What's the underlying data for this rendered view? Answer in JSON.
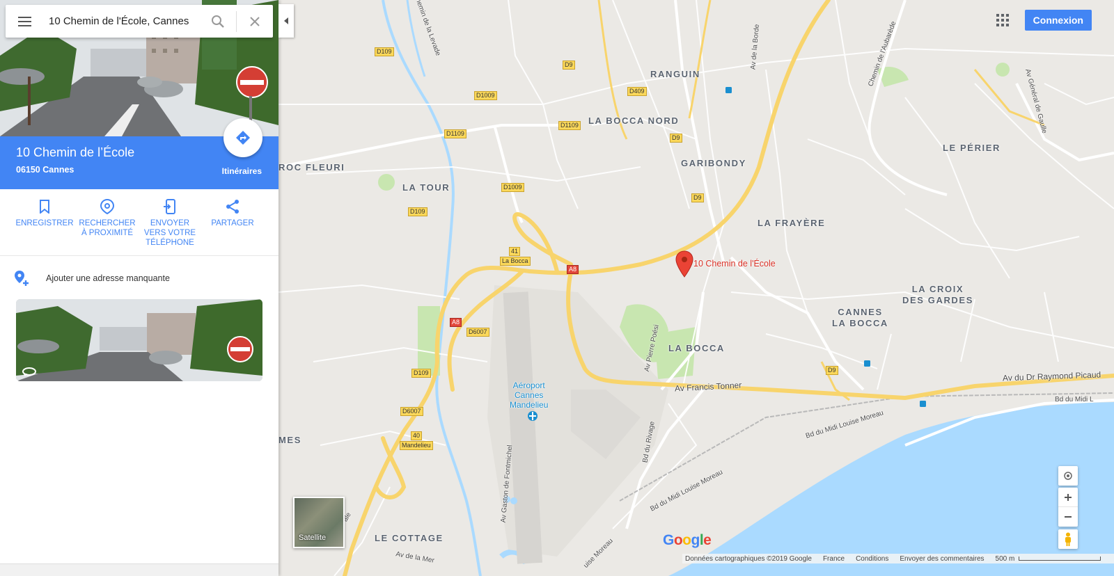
{
  "search": {
    "value": "10 Chemin de l'École, Cannes"
  },
  "place": {
    "title": "10 Chemin de l’École",
    "subtitle": "06150 Cannes",
    "directions_label": "Itinéraires"
  },
  "actions": [
    {
      "label": "ENREGISTRER",
      "icon": "bookmark-icon"
    },
    {
      "label": "RECHERCHER\nÀ PROXIMITÉ",
      "icon": "nearby-icon"
    },
    {
      "label": "ENVOYER\nVERS VOTRE\nTÉLÉPHONE",
      "icon": "send-to-phone-icon"
    },
    {
      "label": "PARTAGER",
      "icon": "share-icon"
    }
  ],
  "add_address_label": "Ajouter une adresse manquante",
  "header_buttons": {
    "signin": "Connexion"
  },
  "map": {
    "pin_label": "10 Chemin de l'École",
    "places": [
      "RANGUIN",
      "LA BOCCA NORD",
      "GARIBONDY",
      "LE PÉRIER",
      "ROC FLEURI",
      "LA TOUR",
      "LA FRAYÈRE",
      "LA CROIX\nDES GARDES",
      "CANNES\nLA BOCCA",
      "LA BOCCA",
      "MES",
      "LE COTTAGE"
    ],
    "streets": [
      "Av Francis Tonner",
      "Av du Dr Raymond Picaud",
      "Bd du Midi Louise Moreau",
      "Bd du Midi Louise Moreau",
      "Bd du Rivage",
      "Av Pierre Poési",
      "Av Gaston de Fontmichel",
      "Chemin de la Levade",
      "Av de la Borde",
      "Chemin de l'Aubarède",
      "Av Général de Gaulle",
      "Bd du Midi L",
      "ale",
      "Av de la Mer",
      "uise Moreau"
    ],
    "shields": [
      "D109",
      "D9",
      "D1009",
      "D409",
      "D1109",
      "D1109",
      "D9",
      "D1009",
      "D9",
      "D109",
      "41",
      "La Bocca",
      "A8",
      "A8",
      "D6007",
      "D109",
      "D6007",
      "40",
      "Mandelieu",
      "D9"
    ],
    "airport": [
      "Aéroport",
      "Cannes",
      "Mandelieu"
    ],
    "satellite_label": "Satellite",
    "logo": "Google"
  },
  "footer": {
    "data": "Données cartographiques ©2019 Google",
    "country": "France",
    "terms": "Conditions",
    "feedback": "Envoyer des commentaires",
    "scale": "500 m"
  },
  "colors": {
    "accent": "#4285f4",
    "pin": "#d93025",
    "water": "#aadaff",
    "road_major": "#fbd96a",
    "park": "#c8e6b0"
  }
}
